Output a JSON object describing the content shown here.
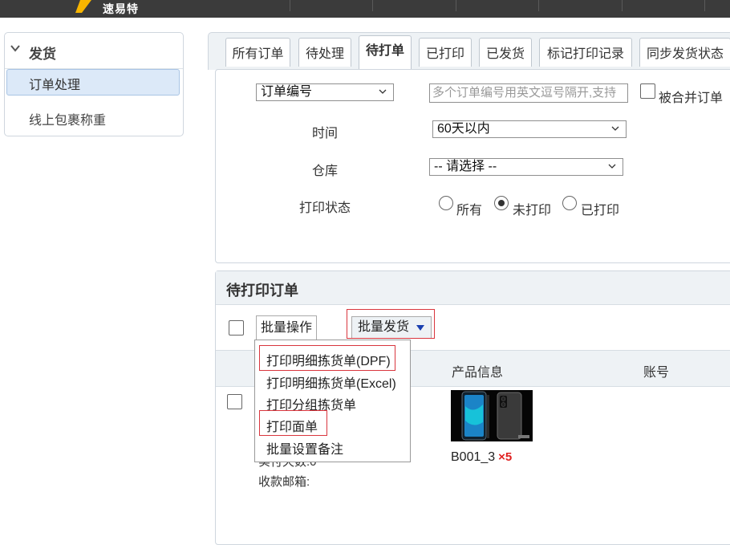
{
  "app": {
    "logo_text": "速易特"
  },
  "sidebar": {
    "section_title": "发货",
    "items": [
      {
        "label": "订单处理",
        "active": true
      },
      {
        "label": "线上包裹称重",
        "active": false
      }
    ]
  },
  "tabs": [
    {
      "label": "所有订单"
    },
    {
      "label": "待处理"
    },
    {
      "label": "待打单",
      "active": true
    },
    {
      "label": "已打印"
    },
    {
      "label": "已发货"
    },
    {
      "label": "标记打印记录"
    },
    {
      "label": "同步发货状态"
    }
  ],
  "filters": {
    "search_field_select": "订单编号",
    "search_placeholder": "多个订单编号用英文逗号隔开,支持",
    "merged_orders_label": "被合并订单",
    "time_label": "时间",
    "time_value": "60天以内",
    "warehouse_label": "仓库",
    "warehouse_value": "-- 请选择 --",
    "print_status_label": "打印状态",
    "print_status_options": [
      "所有",
      "未打印",
      "已打印"
    ],
    "print_status_selected": "未打印"
  },
  "list": {
    "title": "待打印订单",
    "batch_operation_label": "批量操作",
    "batch_ship_label": "批量发货",
    "columns": {
      "product_info": "产品信息",
      "account": "账号"
    },
    "menu_items": [
      "打印明细拣货单(DPF)",
      "打印明细拣货单(Excel)",
      "打印分组拣货单",
      "打印面单",
      "批量设置备注"
    ],
    "row": {
      "partial_text": "实付天数:0",
      "email_label": "收款邮箱:",
      "sku": "B001_3",
      "quantity": "×5"
    }
  },
  "colors": {
    "accent_red": "#d9363e",
    "quantity_red": "#e02020",
    "active_bg": "#dce9f8",
    "panel_bg": "#eef2f5",
    "caret_blue": "#1a3fb0"
  }
}
